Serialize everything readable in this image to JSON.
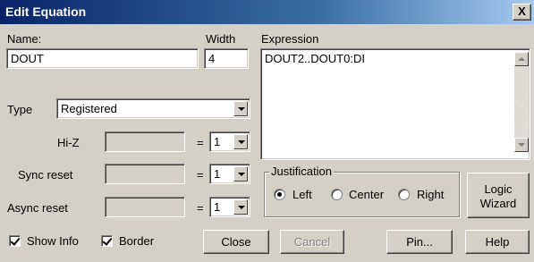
{
  "window": {
    "title": "Edit Equation",
    "close_glyph": "X"
  },
  "name": {
    "label": "Name:",
    "value": "DOUT"
  },
  "width": {
    "label": "Width",
    "value": "4"
  },
  "expression": {
    "label": "Expression",
    "value": "DOUT2..DOUT0:DI"
  },
  "type": {
    "label": "Type",
    "value": "Registered"
  },
  "hiz": {
    "label": "Hi-Z",
    "value": "",
    "equals": "=",
    "level": "1"
  },
  "sync_reset": {
    "label": "Sync reset",
    "value": "",
    "equals": "=",
    "level": "1"
  },
  "async_reset": {
    "label": "Async reset",
    "value": "",
    "equals": "=",
    "level": "1"
  },
  "justification": {
    "label": "Justification",
    "options": [
      "Left",
      "Center",
      "Right"
    ],
    "selected": "Left"
  },
  "buttons": {
    "logic_wizard_1": "Logic",
    "logic_wizard_2": "Wizard",
    "close": "Close",
    "cancel": "Cancel",
    "pin": "Pin...",
    "help": "Help"
  },
  "checkboxes": {
    "show_info": {
      "label": "Show Info",
      "checked": true
    },
    "border": {
      "label": "Border",
      "checked": true
    }
  },
  "icons": {
    "close": "close-icon",
    "dropdown": "chevron-down-icon",
    "scroll_up": "scroll-up-icon",
    "scroll_down": "scroll-down-icon"
  }
}
